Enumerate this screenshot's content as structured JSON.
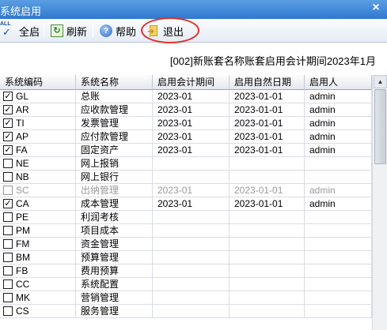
{
  "window": {
    "title": "系统启用",
    "close_glyph": "×"
  },
  "toolbar": {
    "enable_all": {
      "label": "全启",
      "icon": "check-all-icon",
      "icon_text": "ALL",
      "icon_glyph": "✓"
    },
    "refresh": {
      "label": "刷新",
      "icon": "refresh-icon",
      "icon_glyph": "↻"
    },
    "help": {
      "label": "帮助",
      "icon": "help-icon",
      "icon_glyph": "?"
    },
    "exit": {
      "label": "退出",
      "icon": "exit-icon",
      "icon_glyph": "➜"
    }
  },
  "info": {
    "text": "[002]新账套名称账套启用会计期间2023年1月"
  },
  "grid": {
    "columns": [
      "系统编码",
      "系统名称",
      "启用会计期间",
      "启用自然日期",
      "启用人"
    ],
    "rows": [
      {
        "checked": "✓",
        "code": "GL",
        "name": "总账",
        "period": "2023-01",
        "date": "2023-01-01",
        "user": "admin"
      },
      {
        "checked": "✓",
        "code": "AR",
        "name": "应收款管理",
        "period": "2023-01",
        "date": "2023-01-01",
        "user": "admin"
      },
      {
        "checked": "✓",
        "code": "TI",
        "name": "发票管理",
        "period": "2023-01",
        "date": "2023-01-01",
        "user": "admin"
      },
      {
        "checked": "✓",
        "code": "AP",
        "name": "应付款管理",
        "period": "2023-01",
        "date": "2023-01-01",
        "user": "admin"
      },
      {
        "checked": "✓",
        "code": "FA",
        "name": "固定资产",
        "period": "2023-01",
        "date": "2023-01-01",
        "user": "admin"
      },
      {
        "checked": "",
        "code": "NE",
        "name": "网上报销",
        "period": "",
        "date": "",
        "user": ""
      },
      {
        "checked": "",
        "code": "NB",
        "name": "网上银行",
        "period": "",
        "date": "",
        "user": ""
      },
      {
        "checked": "",
        "code": "SC",
        "name": "出纳管理",
        "period": "2023-01",
        "date": "2023-01-01",
        "user": "admin",
        "disabled": true
      },
      {
        "checked": "✓",
        "code": "CA",
        "name": "成本管理",
        "period": "2023-01",
        "date": "2023-01-01",
        "user": "admin"
      },
      {
        "checked": "",
        "code": "PE",
        "name": "利润考核",
        "period": "",
        "date": "",
        "user": ""
      },
      {
        "checked": "",
        "code": "PM",
        "name": "项目成本",
        "period": "",
        "date": "",
        "user": ""
      },
      {
        "checked": "",
        "code": "FM",
        "name": "资金管理",
        "period": "",
        "date": "",
        "user": ""
      },
      {
        "checked": "",
        "code": "BM",
        "name": "预算管理",
        "period": "",
        "date": "",
        "user": ""
      },
      {
        "checked": "",
        "code": "FB",
        "name": "费用预算",
        "period": "",
        "date": "",
        "user": ""
      },
      {
        "checked": "",
        "code": "CC",
        "name": "系统配置",
        "period": "",
        "date": "",
        "user": ""
      },
      {
        "checked": "",
        "code": "MK",
        "name": "营销管理",
        "period": "",
        "date": "",
        "user": ""
      },
      {
        "checked": "",
        "code": "CS",
        "name": "服务管理",
        "period": "",
        "date": "",
        "user": ""
      }
    ]
  },
  "scrollbar": {
    "up_glyph": "▲"
  },
  "colors": {
    "title_bar": "#2f78cf",
    "highlight": "#e0302a",
    "disabled_text": "#9a9a9a"
  }
}
